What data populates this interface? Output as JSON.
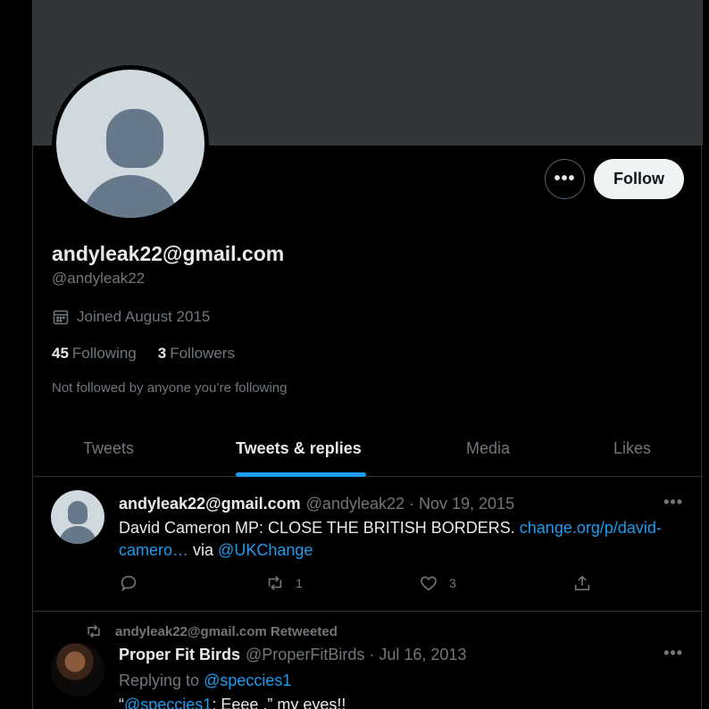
{
  "profile": {
    "display_name": "andyleak22@gmail.com",
    "handle": "@andyleak22",
    "joined": "Joined August 2015",
    "following_count": "45",
    "following_label": "Following",
    "followers_count": "3",
    "followers_label": "Followers",
    "not_followed_text": "Not followed by anyone you’re following",
    "follow_button": "Follow",
    "more_button": "•••"
  },
  "tabs": [
    "Tweets",
    "Tweets & replies",
    "Media",
    "Likes"
  ],
  "tweets": [
    {
      "name": "andyleak22@gmail.com",
      "meta": "@andyleak22 · Nov 19, 2015",
      "text_pre": "David Cameron MP: CLOSE THE BRITISH BORDERS. ",
      "link1": "change.org/p/david-camero…",
      "text_mid": " via ",
      "link2": "@UKChange",
      "reply_count": "",
      "retweet_count": "1",
      "like_count": "3",
      "more": "•••"
    },
    {
      "retweeted_by": "andyleak22@gmail.com Retweeted",
      "name": "Proper Fit Birds",
      "meta": "@ProperFitBirds · Jul 16, 2013",
      "replying_to_label": "Replying to ",
      "replying_to_handle": "@speccies1",
      "text_open_quote": "“",
      "text_mention": "@speccies1",
      "text_rest": ": Eeee ,” my eyes!!",
      "more": "•••"
    }
  ],
  "colors": {
    "background": "#000000",
    "banner": "#333639",
    "accent": "#1d9bf0",
    "secondary_text": "#71767b",
    "primary_text": "#e7e9ea"
  }
}
